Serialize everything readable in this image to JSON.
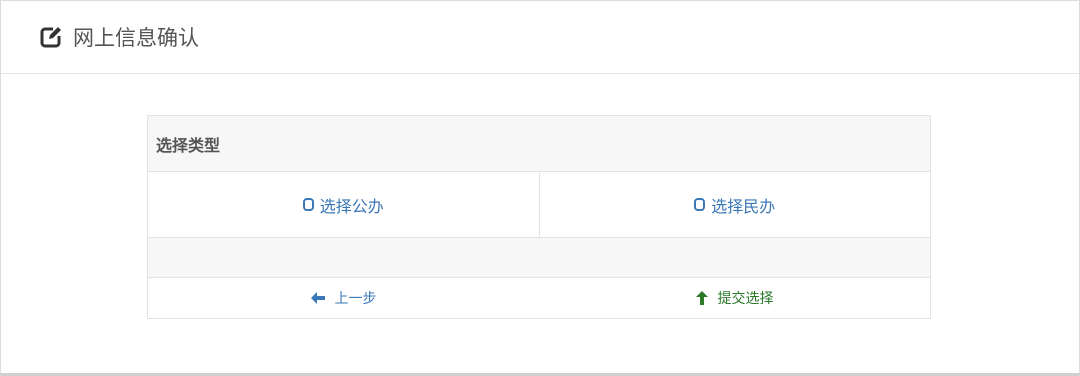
{
  "header": {
    "title": "网上信息确认",
    "icon": "edit-icon"
  },
  "form": {
    "section_title": "选择类型",
    "options": [
      {
        "label": "选择公办",
        "icon": "radio-unchecked-icon"
      },
      {
        "label": "选择民办",
        "icon": "radio-unchecked-icon"
      }
    ],
    "actions": {
      "back_label": "上一步",
      "back_icon": "arrow-left-icon",
      "submit_label": "提交选择",
      "submit_icon": "arrow-up-icon"
    }
  },
  "colors": {
    "link_blue": "#3a78b8",
    "submit_green": "#2a7a2a"
  }
}
